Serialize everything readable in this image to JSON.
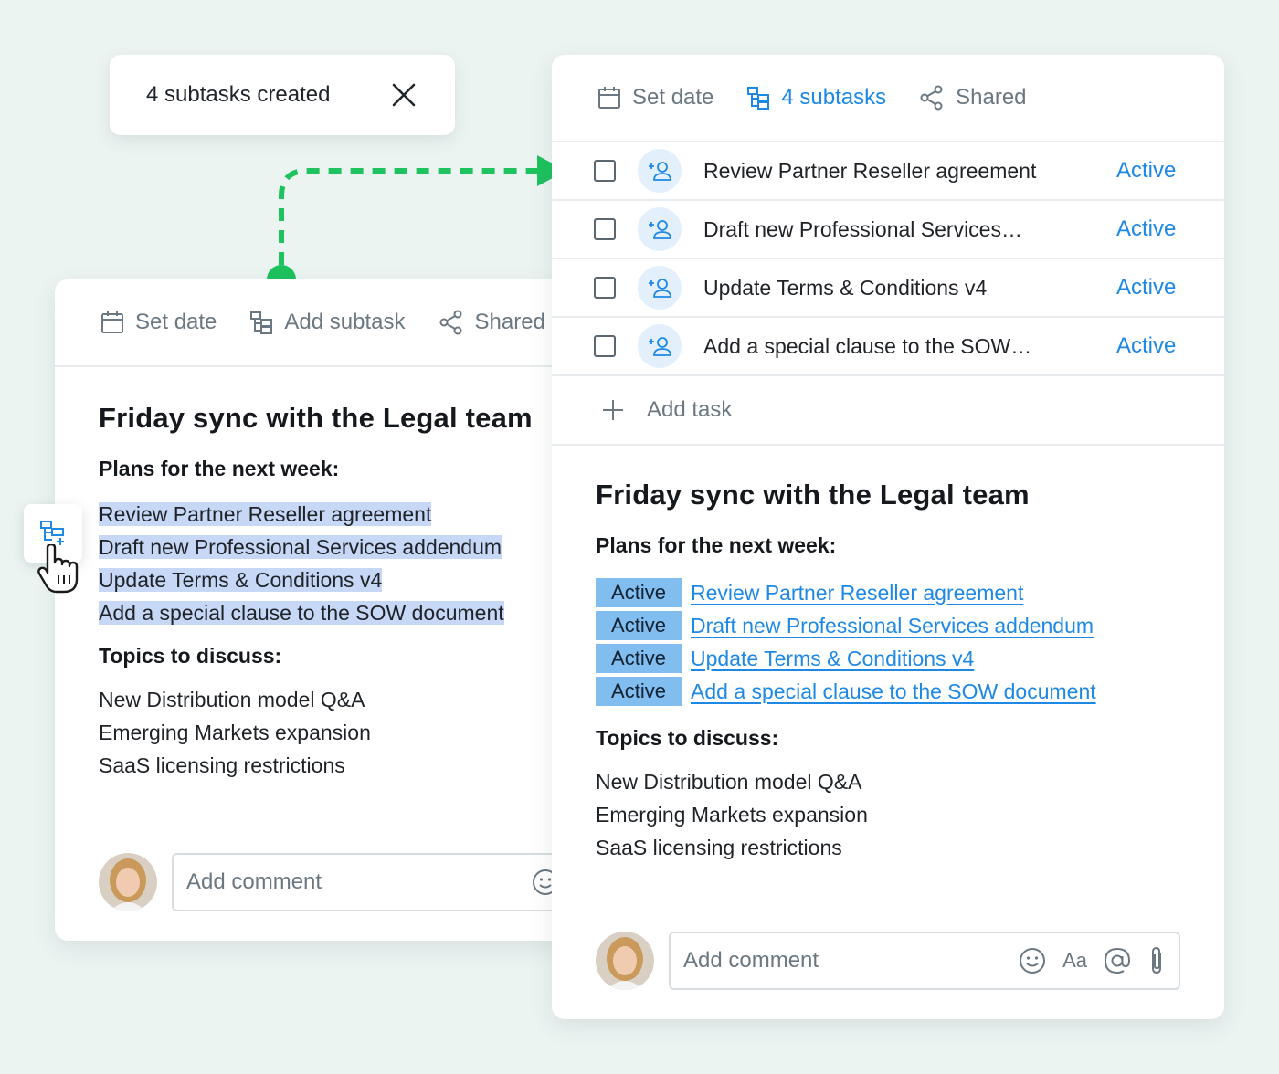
{
  "toast": {
    "text": "4 subtasks created",
    "close_icon": "close-icon"
  },
  "left_card": {
    "toolbar": {
      "set_date": "Set date",
      "add_subtask": "Add subtask",
      "shared": "Shared"
    },
    "title": "Friday sync with the Legal team",
    "plans_heading": "Plans for the next week:",
    "plans": [
      "Review Partner Reseller agreement",
      "Draft new Professional Services addendum",
      "Update Terms & Conditions v4",
      "Add a special clause to the SOW document"
    ],
    "topics_heading": "Topics to discuss:",
    "topics": [
      "New Distribution model Q&A",
      "Emerging Markets expansion",
      "SaaS licensing restrictions"
    ],
    "comment_placeholder": "Add comment"
  },
  "right_card": {
    "toolbar": {
      "set_date": "Set date",
      "subtasks": "4 subtasks",
      "shared": "Shared"
    },
    "tasks": [
      {
        "name": "Review Partner Reseller agreement",
        "status": "Active"
      },
      {
        "name": "Draft new Professional Services…",
        "status": "Active"
      },
      {
        "name": "Update Terms & Conditions v4",
        "status": "Active"
      },
      {
        "name": "Add a special clause to the SOW…",
        "status": "Active"
      }
    ],
    "add_task": "Add task",
    "title": "Friday sync with the Legal team",
    "plans_heading": "Plans for the next week:",
    "plans": [
      {
        "badge": "Active",
        "text": "Review Partner Reseller agreement"
      },
      {
        "badge": "Active",
        "text": "Draft new Professional Services addendum"
      },
      {
        "badge": "Active",
        "text": "Update Terms & Conditions v4"
      },
      {
        "badge": "Active",
        "text": "Add a special clause to the SOW document"
      }
    ],
    "topics_heading": "Topics to discuss:",
    "topics": [
      "New Distribution model Q&A",
      "Emerging Markets expansion",
      "SaaS licensing restrictions"
    ],
    "comment_placeholder": "Add comment",
    "format_label": "Aa"
  },
  "colors": {
    "accent": "#1e88e5",
    "connector": "#1ec25e",
    "selection": "#c7d8f7",
    "badge": "#82bdf0",
    "background": "#ecf4f2"
  }
}
